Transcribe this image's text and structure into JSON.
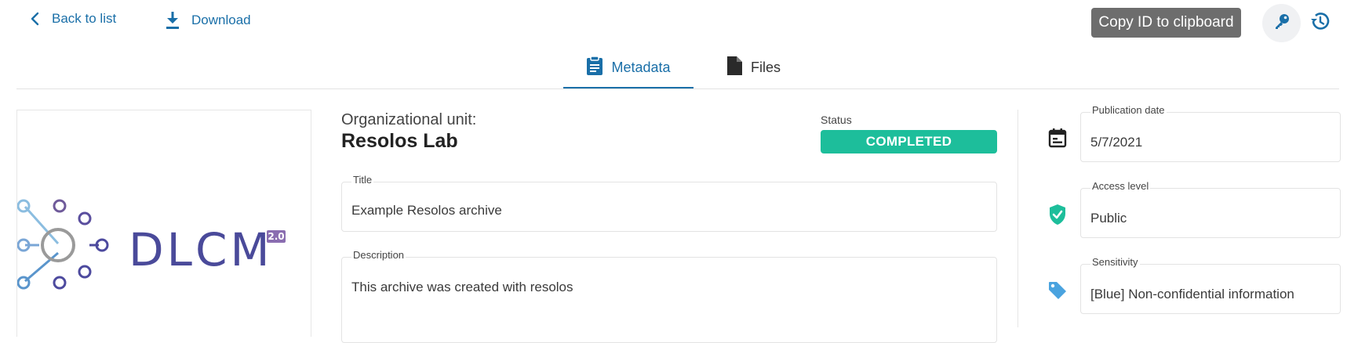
{
  "toolbar": {
    "back_label": "Back to list",
    "download_label": "Download",
    "tooltip": "Copy ID to clipboard"
  },
  "tabs": [
    {
      "label": "Metadata",
      "active": true,
      "icon": "clipboard-icon"
    },
    {
      "label": "Files",
      "active": false,
      "icon": "file-icon"
    }
  ],
  "logo": {
    "text": "DLCM",
    "version": "2.0"
  },
  "org": {
    "label": "Organizational unit:",
    "name": "Resolos Lab"
  },
  "status": {
    "label": "Status",
    "value": "COMPLETED",
    "color": "#1dbe9b"
  },
  "fields": {
    "title": {
      "label": "Title",
      "value": "Example Resolos archive"
    },
    "description": {
      "label": "Description",
      "value": "This archive was created with resolos"
    },
    "publication_date": {
      "label": "Publication date",
      "value": "5/7/2021"
    },
    "access_level": {
      "label": "Access level",
      "value": "Public"
    },
    "sensitivity": {
      "label": "Sensitivity",
      "value": "[Blue] Non-confidential information"
    }
  },
  "colors": {
    "accent": "#1a6fa8",
    "status_green": "#1dbe9b",
    "shield_green": "#1dbe9b",
    "tag_blue": "#4aa3df"
  }
}
